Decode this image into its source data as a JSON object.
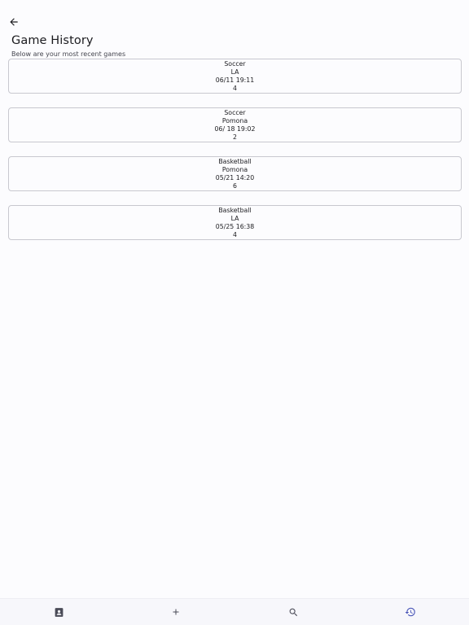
{
  "header": {
    "title": "Game History",
    "subtitle": "Below are your most recent games"
  },
  "games": [
    {
      "sport": "Soccer",
      "location": "LA",
      "datetime": "06/11 19:11",
      "count": "4"
    },
    {
      "sport": "Soccer",
      "location": "Pomona",
      "datetime": "06/ 18 19:02",
      "count": "2"
    },
    {
      "sport": "Basketball",
      "location": "Pomona",
      "datetime": "05/21 14:20",
      "count": "6"
    },
    {
      "sport": "Basketball",
      "location": "LA",
      "datetime": "05/25 16:38",
      "count": "4"
    }
  ],
  "icons": {
    "back": "arrow-back-icon",
    "nav": [
      "contact-book-icon",
      "add-icon",
      "search-icon",
      "history-icon"
    ]
  },
  "colors": {
    "active_nav": "#4a56b8",
    "inactive_nav": "#4a4b57",
    "card_border": "#c8c8cf",
    "background": "#fcfcfe"
  }
}
